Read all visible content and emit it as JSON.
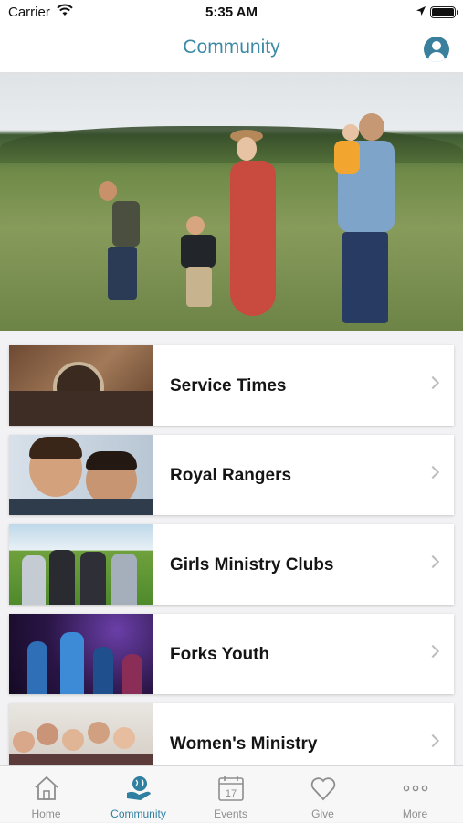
{
  "status_bar": {
    "carrier": "Carrier",
    "time": "5:35 AM"
  },
  "nav": {
    "title": "Community"
  },
  "hero": {
    "image": "family-walking-in-field"
  },
  "items": [
    {
      "label": "Service Times",
      "thumb": "wristwatch-photo"
    },
    {
      "label": "Royal Rangers",
      "thumb": "boys-smiling-photo"
    },
    {
      "label": "Girls Ministry Clubs",
      "thumb": "girls-heart-hands-photo"
    },
    {
      "label": "Forks Youth",
      "thumb": "youth-worship-photo"
    },
    {
      "label": "Women's Ministry",
      "thumb": "women-group-photo"
    }
  ],
  "tabs": [
    {
      "label": "Home",
      "icon": "house-icon",
      "active": false
    },
    {
      "label": "Community",
      "icon": "globe-hands-icon",
      "active": true
    },
    {
      "label": "Events",
      "icon": "calendar-icon",
      "active": false,
      "badge": "17"
    },
    {
      "label": "Give",
      "icon": "heart-icon",
      "active": false
    },
    {
      "label": "More",
      "icon": "ellipsis-icon",
      "active": false
    }
  ],
  "colors": {
    "accent": "#3c8aa6",
    "tab_inactive": "#8e8e8e"
  }
}
